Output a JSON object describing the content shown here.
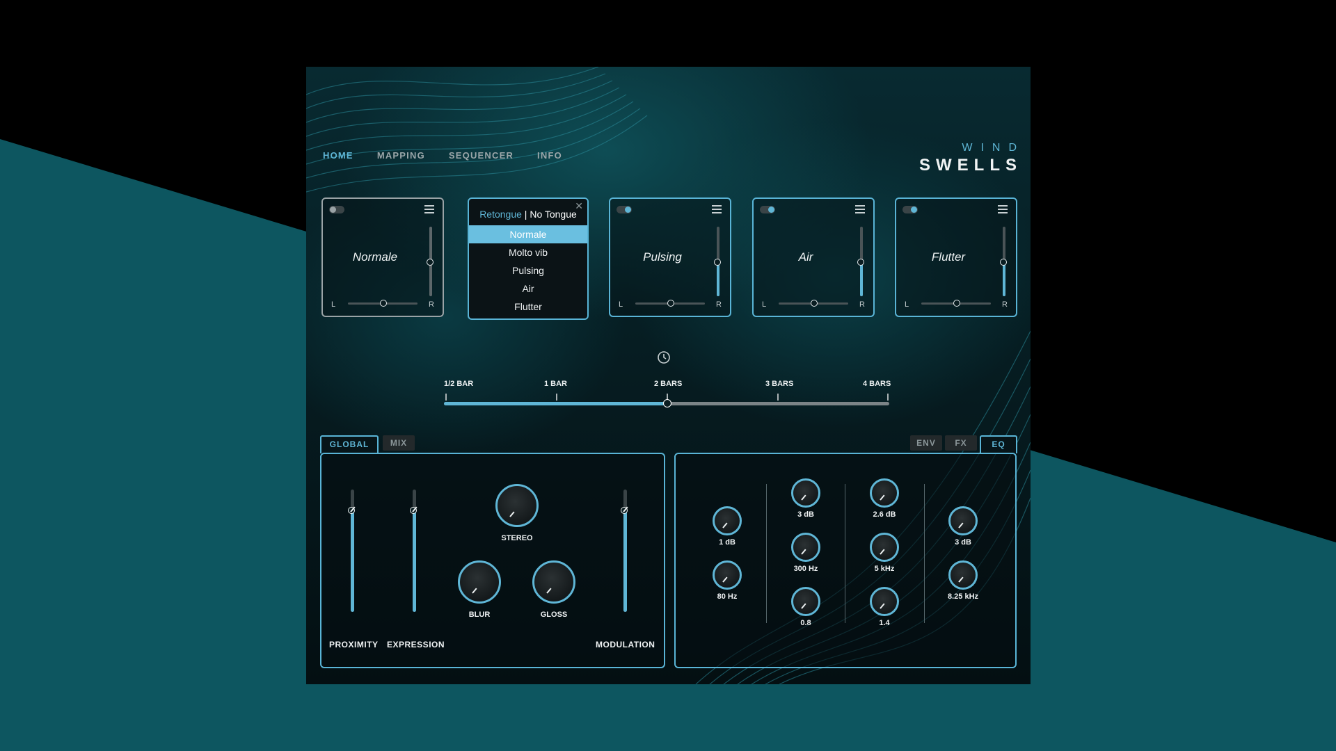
{
  "nav": {
    "items": [
      "HOME",
      "MAPPING",
      "SEQUENCER",
      "INFO"
    ],
    "active": "HOME"
  },
  "logo": {
    "line1": "WIND",
    "line2": "SWELLS"
  },
  "cards": [
    {
      "name": "Normale",
      "enabled": false,
      "pan_label_left": "L",
      "pan_label_right": "R",
      "volume": 0.5,
      "pan": 0.5
    },
    {
      "name": "Pulsing",
      "enabled": true,
      "pan_label_left": "L",
      "pan_label_right": "R",
      "volume": 0.5,
      "pan": 0.5
    },
    {
      "name": "Air",
      "enabled": true,
      "pan_label_left": "L",
      "pan_label_right": "R",
      "volume": 0.5,
      "pan": 0.5
    },
    {
      "name": "Flutter",
      "enabled": true,
      "pan_label_left": "L",
      "pan_label_right": "R",
      "volume": 0.5,
      "pan": 0.5
    }
  ],
  "dropdown": {
    "header_accent": "Retongue",
    "header_separator": " | ",
    "header_rest": "No Tongue",
    "options": [
      "Normale",
      "Molto vib",
      "Pulsing",
      "Air",
      "Flutter"
    ],
    "selected": "Normale"
  },
  "bar_ruler": {
    "ticks": [
      "1/2 BAR",
      "1 BAR",
      "2 BARS",
      "3 BARS",
      "4 BARS"
    ],
    "value": "2 BARS"
  },
  "left_tabs": {
    "global": "GLOBAL",
    "mix": "MIX"
  },
  "right_tabs": {
    "env": "ENV",
    "fx": "FX",
    "eq": "EQ"
  },
  "global_panel": {
    "proximity": {
      "label": "PROXIMITY",
      "value": 0.83
    },
    "expression": {
      "label": "EXPRESSION",
      "value": 0.83
    },
    "modulation": {
      "label": "MODULATION",
      "value": 0.83
    },
    "stereo": {
      "label": "STEREO"
    },
    "blur": {
      "label": "BLUR"
    },
    "gloss": {
      "label": "GLOSS"
    }
  },
  "eq_panel": {
    "band1": {
      "gain": "1 dB",
      "freq": "80 Hz",
      "shape": "low-shelf-icon"
    },
    "band2": {
      "gain": "3 dB",
      "freq": "300 Hz",
      "q": "0.8",
      "shape": "bell-icon"
    },
    "band3": {
      "gain": "2.6 dB",
      "freq": "5 kHz",
      "q": "1.4",
      "shape": "peak-icon"
    },
    "band4": {
      "gain": "3 dB",
      "freq": "8.25 kHz",
      "shape": "high-shelf-icon"
    }
  },
  "colors": {
    "accent": "#5fb6d6",
    "teal_band": "#0d5660",
    "background": "#000000"
  }
}
